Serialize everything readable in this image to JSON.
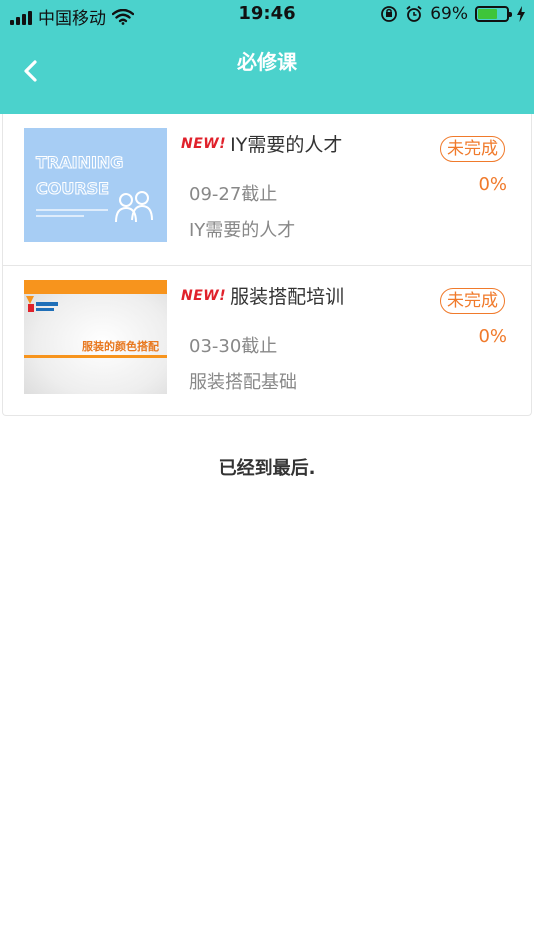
{
  "status_bar": {
    "carrier": "中国移动",
    "time": "19:46",
    "battery_percent": "69%",
    "battery_level": 0.69,
    "icons": [
      "signal-icon",
      "wifi-icon",
      "orientation-lock-icon",
      "alarm-icon",
      "battery-icon",
      "charging-icon"
    ]
  },
  "nav": {
    "title": "必修课",
    "back_icon": "chevron-left-icon"
  },
  "courses": [
    {
      "badge": "NEW!",
      "title": "IY需要的人才",
      "deadline": "09-27截止",
      "subtitle": "IY需要的人才",
      "status": "未完成",
      "progress": "0%",
      "thumbnail": {
        "line1": "TRAINING",
        "line2": "COURSE"
      }
    },
    {
      "badge": "NEW!",
      "title": "服装搭配培训",
      "deadline": "03-30截止",
      "subtitle": "服装搭配基础",
      "status": "未完成",
      "progress": "0%",
      "thumbnail": {
        "caption": "服装的颜色搭配"
      }
    }
  ],
  "footer": {
    "end_text": "已经到最后."
  },
  "colors": {
    "header_bg": "#4bd2cc",
    "accent_orange": "#f07a2b",
    "new_red": "#e0212b",
    "thumb_blue": "#a7cdf4",
    "thumb_orange": "#f7941d"
  }
}
